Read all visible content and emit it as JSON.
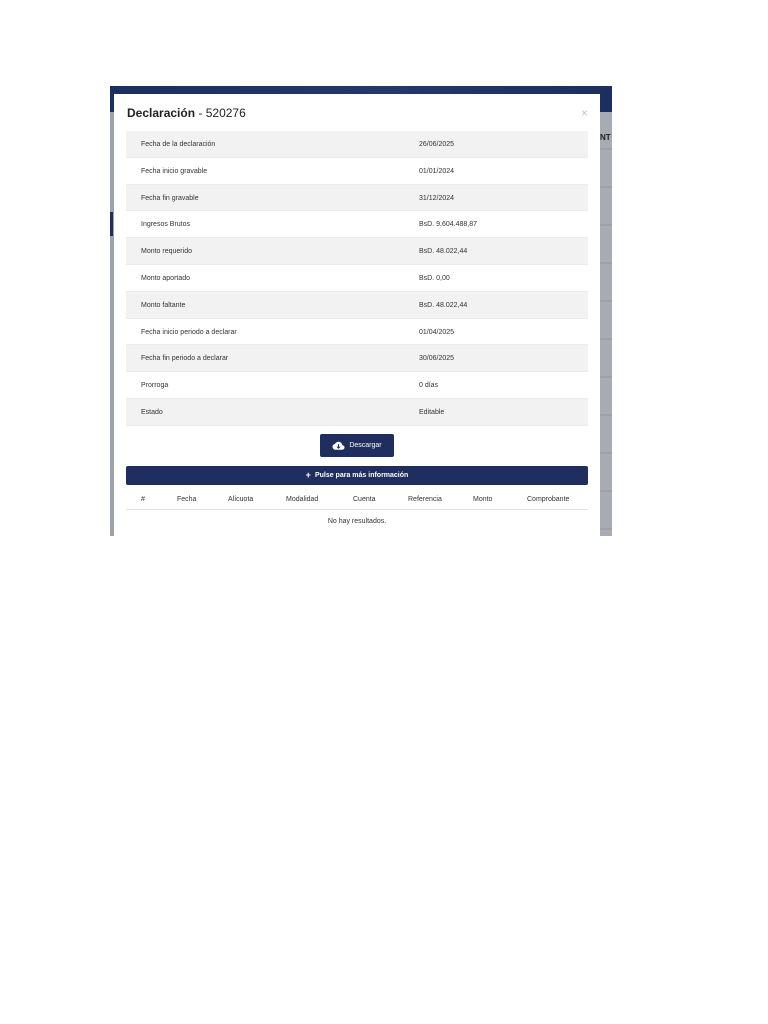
{
  "modal": {
    "title_prefix": "Declaración",
    "title_separator": " - ",
    "title_number": "520276",
    "close_symbol": "×"
  },
  "background": {
    "header_color": "#1f2e5e",
    "partial_column_text": "NT"
  },
  "details": [
    {
      "label": "Fecha de la declaración",
      "value": "26/06/2025"
    },
    {
      "label": "Fecha inicio gravable",
      "value": "01/01/2024"
    },
    {
      "label": "Fecha fin gravable",
      "value": "31/12/2024"
    },
    {
      "label": "Ingresos Brutos",
      "value": "BsD. 9.604.488,87"
    },
    {
      "label": "Monto requerido",
      "value": "BsD. 48.022,44"
    },
    {
      "label": "Monto aportado",
      "value": "BsD. 0,00"
    },
    {
      "label": "Monto faltante",
      "value": "BsD. 48.022,44"
    },
    {
      "label": "Fecha inicio periodo a declarar",
      "value": "01/04/2025"
    },
    {
      "label": "Fecha fin periodo a declarar",
      "value": "30/06/2025"
    },
    {
      "label": "Prorroga",
      "value": "0 días"
    },
    {
      "label": "Estado",
      "value": "Editable"
    }
  ],
  "download_button": {
    "label": "Descargar",
    "icon": "cloud-download-icon"
  },
  "info_bar": {
    "label": "Pulse para más información",
    "icon": "plus-icon"
  },
  "table": {
    "columns": [
      "#",
      "Fecha",
      "Alícuota",
      "Modalidad",
      "Cuenta",
      "Referencia",
      "Monto",
      "Comprobante"
    ],
    "empty_message": "No hay resultados."
  },
  "colors": {
    "accent": "#1f2e5e",
    "row_stripe": "#f2f2f2",
    "backdrop": "#9a9ea6"
  }
}
